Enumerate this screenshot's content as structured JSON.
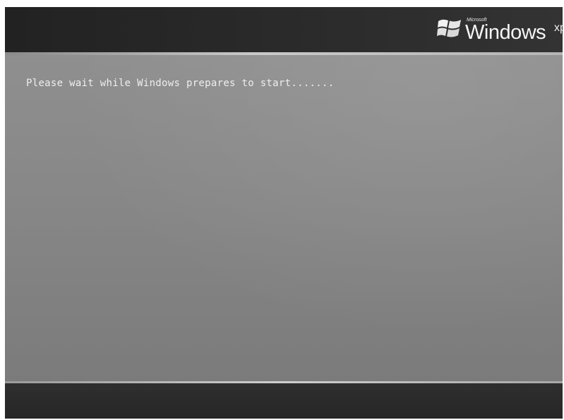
{
  "boot_screen": {
    "status_message": "Please wait while Windows prepares to start.......",
    "logo": {
      "maker": "Microsoft",
      "product": "Windows",
      "edition": "xp",
      "icon": "windows-flag-icon"
    }
  }
}
